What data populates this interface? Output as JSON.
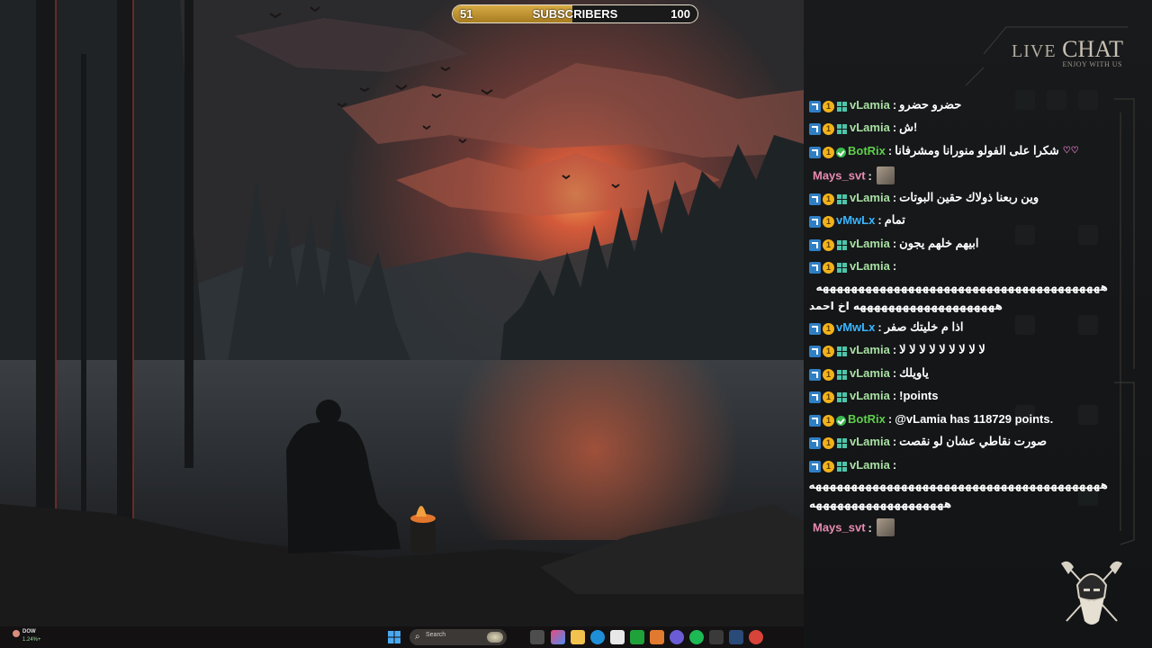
{
  "goal": {
    "current": "51",
    "label": "SUBSCRIBERS",
    "target": "100",
    "progress_fraction": 0.49
  },
  "chat": {
    "title_live": "LIVE",
    "title_chat": "CHAT",
    "subtitle": "ENJOY WITH US",
    "separator": ":",
    "messages": [
      {
        "user": "vLamia",
        "user_color": "#a8e0a2",
        "badges": [
          "arrow",
          "coin",
          "grid"
        ],
        "text": "حضرو حضرو"
      },
      {
        "user": "vLamia",
        "user_color": "#a8e0a2",
        "badges": [
          "arrow",
          "coin",
          "grid"
        ],
        "text": "ش!"
      },
      {
        "user": "BotRix",
        "user_color": "#5fcf4a",
        "badges": [
          "arrow",
          "coin",
          "check"
        ],
        "text": "شكرا على الفولو منورانا ومشرفانا"
      },
      {
        "user": "Mays_svt",
        "user_color": "#e98bb1",
        "badges": [],
        "text": ""
      },
      {
        "user": "vLamia",
        "user_color": "#a8e0a2",
        "badges": [
          "arrow",
          "coin",
          "grid"
        ],
        "text": "وين ربعنا ذولاك حقين البوتات"
      },
      {
        "user": "vMwLx",
        "user_color": "#39b6ff",
        "badges": [
          "arrow",
          "coin"
        ],
        "text": "تمام"
      },
      {
        "user": "vLamia",
        "user_color": "#a8e0a2",
        "badges": [
          "arrow",
          "coin",
          "grid"
        ],
        "text": "ابيهم خلهم يجون"
      },
      {
        "user": "vLamia",
        "user_color": "#a8e0a2",
        "badges": [
          "arrow",
          "coin",
          "grid"
        ],
        "text": ""
      },
      {
        "user": "vMwLx",
        "user_color": "#39b6ff",
        "badges": [
          "arrow",
          "coin"
        ],
        "text": "اذا م خليتك صفر"
      },
      {
        "user": "vLamia",
        "user_color": "#a8e0a2",
        "badges": [
          "arrow",
          "coin",
          "grid"
        ],
        "text": "لا لا لا لا لا لا لا لا لا"
      },
      {
        "user": "vLamia",
        "user_color": "#a8e0a2",
        "badges": [
          "arrow",
          "coin",
          "grid"
        ],
        "text": "ياويلك"
      },
      {
        "user": "vLamia",
        "user_color": "#a8e0a2",
        "badges": [
          "arrow",
          "coin",
          "grid"
        ],
        "text": "!points"
      },
      {
        "user": "BotRix",
        "user_color": "#5fcf4a",
        "badges": [
          "arrow",
          "coin",
          "check"
        ],
        "text": "@vLamia has 118729 points."
      },
      {
        "user": "vLamia",
        "user_color": "#a8e0a2",
        "badges": [
          "arrow",
          "coin",
          "grid"
        ],
        "text": "صورت نقاطي عشان لو نقصت"
      },
      {
        "user": "vLamia",
        "user_color": "#a8e0a2",
        "badges": [
          "arrow",
          "coin",
          "grid"
        ],
        "text": ""
      },
      {
        "user": "Mays_svt",
        "user_color": "#e98bb1",
        "badges": [],
        "text": ""
      }
    ],
    "long_lines": {
      "line_a1": "ههههههههههههههههههههههههههههههههههههههههه",
      "line_a2": "ههههههههههههههههههههه اخ احمد",
      "line_b1": "هههههههههههههههههههههههههههههههههههههههههه",
      "line_b2": "هههههههههههههههههههه"
    }
  },
  "taskbar": {
    "weather_label": "DOW",
    "weather_sub": "1.24%+",
    "search_placeholder": "Search"
  }
}
